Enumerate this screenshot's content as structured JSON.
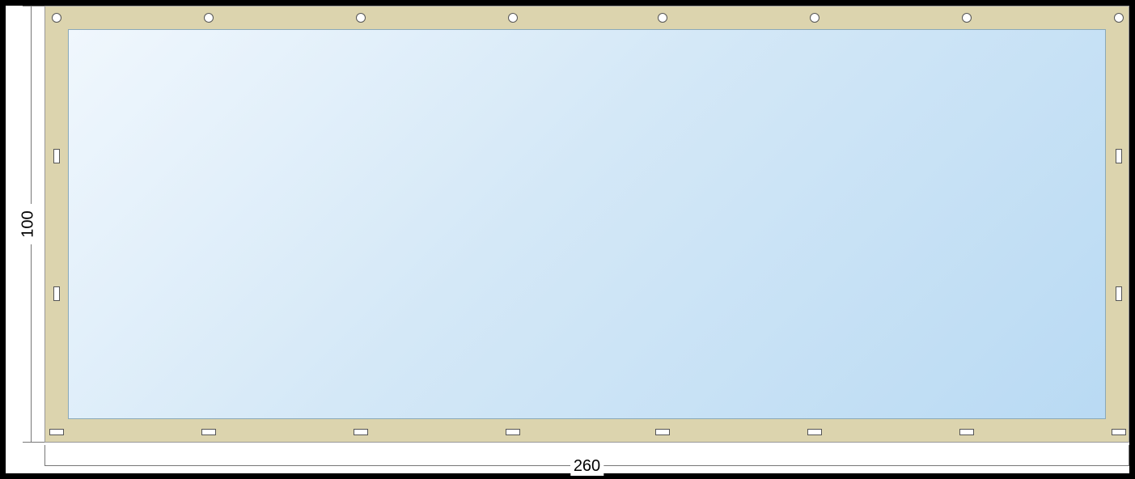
{
  "dimensions": {
    "height_label": "100",
    "width_label": "260"
  },
  "tarp": {
    "border_color": "#dcd4ae",
    "panel_gradient_start": "#f0f7fd",
    "panel_gradient_end": "#b9daf3"
  },
  "fasteners": {
    "top_grommets_count": 8,
    "bottom_slots_count": 8,
    "side_slots_per_side": 2
  }
}
